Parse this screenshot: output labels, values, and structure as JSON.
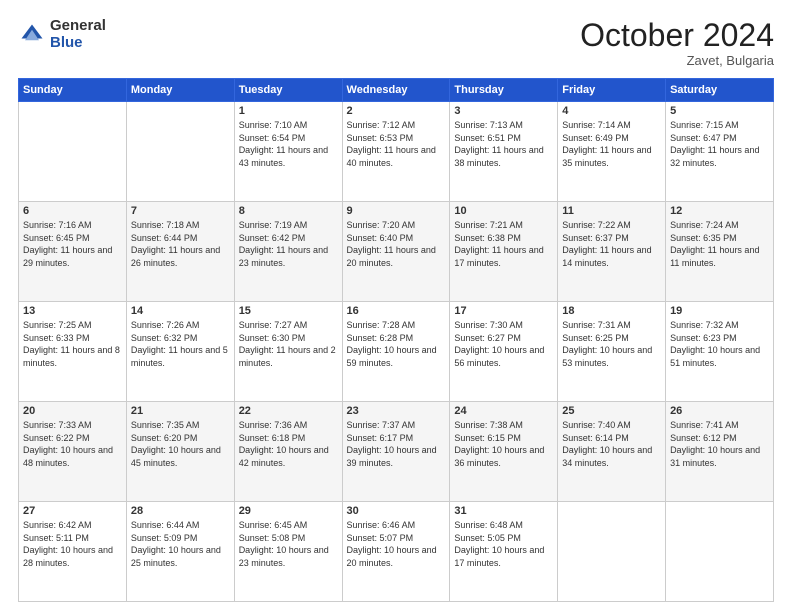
{
  "header": {
    "logo_general": "General",
    "logo_blue": "Blue",
    "month_title": "October 2024",
    "location": "Zavet, Bulgaria"
  },
  "days_of_week": [
    "Sunday",
    "Monday",
    "Tuesday",
    "Wednesday",
    "Thursday",
    "Friday",
    "Saturday"
  ],
  "weeks": [
    [
      {
        "day": "",
        "sunrise": "",
        "sunset": "",
        "daylight": ""
      },
      {
        "day": "",
        "sunrise": "",
        "sunset": "",
        "daylight": ""
      },
      {
        "day": "1",
        "sunrise": "Sunrise: 7:10 AM",
        "sunset": "Sunset: 6:54 PM",
        "daylight": "Daylight: 11 hours and 43 minutes."
      },
      {
        "day": "2",
        "sunrise": "Sunrise: 7:12 AM",
        "sunset": "Sunset: 6:53 PM",
        "daylight": "Daylight: 11 hours and 40 minutes."
      },
      {
        "day": "3",
        "sunrise": "Sunrise: 7:13 AM",
        "sunset": "Sunset: 6:51 PM",
        "daylight": "Daylight: 11 hours and 38 minutes."
      },
      {
        "day": "4",
        "sunrise": "Sunrise: 7:14 AM",
        "sunset": "Sunset: 6:49 PM",
        "daylight": "Daylight: 11 hours and 35 minutes."
      },
      {
        "day": "5",
        "sunrise": "Sunrise: 7:15 AM",
        "sunset": "Sunset: 6:47 PM",
        "daylight": "Daylight: 11 hours and 32 minutes."
      }
    ],
    [
      {
        "day": "6",
        "sunrise": "Sunrise: 7:16 AM",
        "sunset": "Sunset: 6:45 PM",
        "daylight": "Daylight: 11 hours and 29 minutes."
      },
      {
        "day": "7",
        "sunrise": "Sunrise: 7:18 AM",
        "sunset": "Sunset: 6:44 PM",
        "daylight": "Daylight: 11 hours and 26 minutes."
      },
      {
        "day": "8",
        "sunrise": "Sunrise: 7:19 AM",
        "sunset": "Sunset: 6:42 PM",
        "daylight": "Daylight: 11 hours and 23 minutes."
      },
      {
        "day": "9",
        "sunrise": "Sunrise: 7:20 AM",
        "sunset": "Sunset: 6:40 PM",
        "daylight": "Daylight: 11 hours and 20 minutes."
      },
      {
        "day": "10",
        "sunrise": "Sunrise: 7:21 AM",
        "sunset": "Sunset: 6:38 PM",
        "daylight": "Daylight: 11 hours and 17 minutes."
      },
      {
        "day": "11",
        "sunrise": "Sunrise: 7:22 AM",
        "sunset": "Sunset: 6:37 PM",
        "daylight": "Daylight: 11 hours and 14 minutes."
      },
      {
        "day": "12",
        "sunrise": "Sunrise: 7:24 AM",
        "sunset": "Sunset: 6:35 PM",
        "daylight": "Daylight: 11 hours and 11 minutes."
      }
    ],
    [
      {
        "day": "13",
        "sunrise": "Sunrise: 7:25 AM",
        "sunset": "Sunset: 6:33 PM",
        "daylight": "Daylight: 11 hours and 8 minutes."
      },
      {
        "day": "14",
        "sunrise": "Sunrise: 7:26 AM",
        "sunset": "Sunset: 6:32 PM",
        "daylight": "Daylight: 11 hours and 5 minutes."
      },
      {
        "day": "15",
        "sunrise": "Sunrise: 7:27 AM",
        "sunset": "Sunset: 6:30 PM",
        "daylight": "Daylight: 11 hours and 2 minutes."
      },
      {
        "day": "16",
        "sunrise": "Sunrise: 7:28 AM",
        "sunset": "Sunset: 6:28 PM",
        "daylight": "Daylight: 10 hours and 59 minutes."
      },
      {
        "day": "17",
        "sunrise": "Sunrise: 7:30 AM",
        "sunset": "Sunset: 6:27 PM",
        "daylight": "Daylight: 10 hours and 56 minutes."
      },
      {
        "day": "18",
        "sunrise": "Sunrise: 7:31 AM",
        "sunset": "Sunset: 6:25 PM",
        "daylight": "Daylight: 10 hours and 53 minutes."
      },
      {
        "day": "19",
        "sunrise": "Sunrise: 7:32 AM",
        "sunset": "Sunset: 6:23 PM",
        "daylight": "Daylight: 10 hours and 51 minutes."
      }
    ],
    [
      {
        "day": "20",
        "sunrise": "Sunrise: 7:33 AM",
        "sunset": "Sunset: 6:22 PM",
        "daylight": "Daylight: 10 hours and 48 minutes."
      },
      {
        "day": "21",
        "sunrise": "Sunrise: 7:35 AM",
        "sunset": "Sunset: 6:20 PM",
        "daylight": "Daylight: 10 hours and 45 minutes."
      },
      {
        "day": "22",
        "sunrise": "Sunrise: 7:36 AM",
        "sunset": "Sunset: 6:18 PM",
        "daylight": "Daylight: 10 hours and 42 minutes."
      },
      {
        "day": "23",
        "sunrise": "Sunrise: 7:37 AM",
        "sunset": "Sunset: 6:17 PM",
        "daylight": "Daylight: 10 hours and 39 minutes."
      },
      {
        "day": "24",
        "sunrise": "Sunrise: 7:38 AM",
        "sunset": "Sunset: 6:15 PM",
        "daylight": "Daylight: 10 hours and 36 minutes."
      },
      {
        "day": "25",
        "sunrise": "Sunrise: 7:40 AM",
        "sunset": "Sunset: 6:14 PM",
        "daylight": "Daylight: 10 hours and 34 minutes."
      },
      {
        "day": "26",
        "sunrise": "Sunrise: 7:41 AM",
        "sunset": "Sunset: 6:12 PM",
        "daylight": "Daylight: 10 hours and 31 minutes."
      }
    ],
    [
      {
        "day": "27",
        "sunrise": "Sunrise: 6:42 AM",
        "sunset": "Sunset: 5:11 PM",
        "daylight": "Daylight: 10 hours and 28 minutes."
      },
      {
        "day": "28",
        "sunrise": "Sunrise: 6:44 AM",
        "sunset": "Sunset: 5:09 PM",
        "daylight": "Daylight: 10 hours and 25 minutes."
      },
      {
        "day": "29",
        "sunrise": "Sunrise: 6:45 AM",
        "sunset": "Sunset: 5:08 PM",
        "daylight": "Daylight: 10 hours and 23 minutes."
      },
      {
        "day": "30",
        "sunrise": "Sunrise: 6:46 AM",
        "sunset": "Sunset: 5:07 PM",
        "daylight": "Daylight: 10 hours and 20 minutes."
      },
      {
        "day": "31",
        "sunrise": "Sunrise: 6:48 AM",
        "sunset": "Sunset: 5:05 PM",
        "daylight": "Daylight: 10 hours and 17 minutes."
      },
      {
        "day": "",
        "sunrise": "",
        "sunset": "",
        "daylight": ""
      },
      {
        "day": "",
        "sunrise": "",
        "sunset": "",
        "daylight": ""
      }
    ]
  ]
}
